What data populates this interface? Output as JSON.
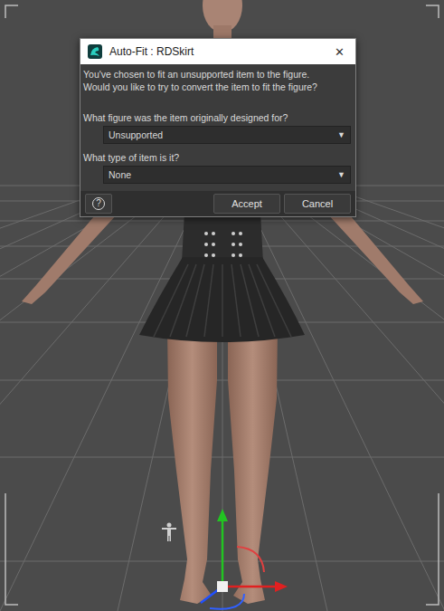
{
  "window": {
    "title": "Auto-Fit : RDSkirt",
    "close": "✕"
  },
  "message": [
    "You've chosen to fit an unsupported item to the figure.",
    "Would you like to try to convert the item to fit the figure?"
  ],
  "fields": [
    {
      "label": "What figure was the item originally designed for?",
      "value": "Unsupported",
      "arrow": "▼"
    },
    {
      "label": "What type of item is it?",
      "value": "None",
      "arrow": "▼"
    }
  ],
  "help": "?",
  "buttons": [
    "Accept",
    "Cancel"
  ]
}
